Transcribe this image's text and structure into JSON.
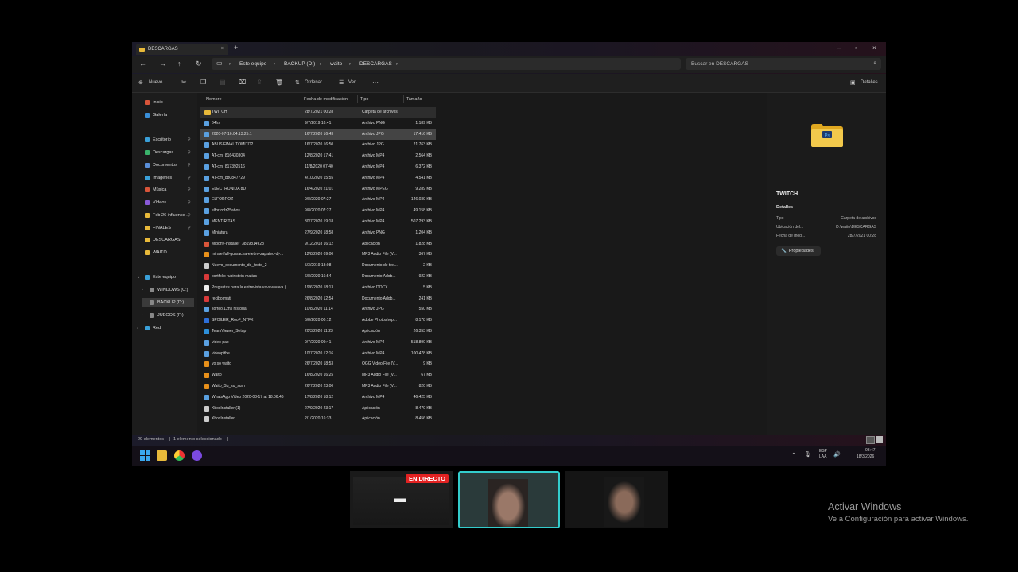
{
  "window": {
    "tab_title": "DESCARGAS",
    "tab_close": "×",
    "new_tab": "+",
    "minimize": "–",
    "maximize": "▫",
    "close": "×"
  },
  "address": {
    "crumbs": [
      "Este equipo",
      "BACKUP (D:)",
      "waito",
      "DESCARGAS"
    ],
    "separator": "›",
    "search_placeholder": "Buscar en DESCARGAS"
  },
  "toolbar": {
    "new_label": "Nuevo",
    "sort_label": "Ordenar",
    "view_label": "Ver",
    "more_label": "···",
    "details_label": "Detalles"
  },
  "sidebar": {
    "items": [
      {
        "label": "Inicio",
        "color": "#d9553a",
        "pinned": false
      },
      {
        "label": "Galería",
        "color": "#3a8fd9",
        "pinned": false
      },
      {
        "label": "Escritorio",
        "color": "#3aa0d9",
        "pinned": true
      },
      {
        "label": "Descargas",
        "color": "#3ab36b",
        "pinned": true
      },
      {
        "label": "Documentos",
        "color": "#5a8fd9",
        "pinned": true
      },
      {
        "label": "Imágenes",
        "color": "#3aa0d9",
        "pinned": true
      },
      {
        "label": "Música",
        "color": "#d9553a",
        "pinned": true
      },
      {
        "label": "Vídeos",
        "color": "#8a5ad9",
        "pinned": true
      },
      {
        "label": "Feb 26 influence ...",
        "color": "#e8b93a",
        "pinned": true
      },
      {
        "label": "FINALES",
        "color": "#e8b93a",
        "pinned": true
      },
      {
        "label": "DESCARGAS",
        "color": "#e8b93a",
        "pinned": false
      },
      {
        "label": "WAITO",
        "color": "#e8b93a",
        "pinned": false
      }
    ],
    "tree": [
      {
        "label": "Este equipo",
        "color": "#3aa0d9"
      },
      {
        "label": "WINDOWS (C:)",
        "color": "#888888"
      },
      {
        "label": "BACKUP (D:)",
        "color": "#888888"
      },
      {
        "label": "JUEGOS (F:)",
        "color": "#888888"
      },
      {
        "label": "Red",
        "color": "#3aa0d9"
      }
    ]
  },
  "columns": {
    "name": "Nombre",
    "date": "Fecha de modificación",
    "type": "Tipo",
    "size": "Tamaño"
  },
  "files": [
    {
      "name": "TWITCH",
      "date": "28/7/2021 00:28",
      "type": "Carpeta de archivos",
      "size": "",
      "color": "#e8b93a"
    },
    {
      "name": "64hs",
      "date": "9/7/2019 18:41",
      "type": "Archivo PNG",
      "size": "1.189 KB",
      "color": "#5aa0e0"
    },
    {
      "name": "2020-07-16.04.13.25.1",
      "date": "16/7/2020 16:43",
      "type": "Archivo JPG",
      "size": "17.416 KB",
      "color": "#5aa0e0"
    },
    {
      "name": "ABUS FINAL TOMITO2",
      "date": "16/7/2020 16:50",
      "type": "Archivo JPG",
      "size": "21.763 KB",
      "color": "#5aa0e0"
    },
    {
      "name": "AT-cm_816430304",
      "date": "12/8/2020 17:41",
      "type": "Archivo MP4",
      "size": "2.564 KB",
      "color": "#5aa0e0"
    },
    {
      "name": "AT-cm_817392516",
      "date": "11/8/2020 07:40",
      "type": "Archivo MP4",
      "size": "6.372 KB",
      "color": "#5aa0e0"
    },
    {
      "name": "AT-cm_880847729",
      "date": "4/10/2020 15:55",
      "type": "Archivo MP4",
      "size": "4.541 KB",
      "color": "#5aa0e0"
    },
    {
      "name": "ELECTRONIDA 8D",
      "date": "16/4/2020 21:01",
      "type": "Archivo MPEG",
      "size": "9.289 KB",
      "color": "#5aa0e0"
    },
    {
      "name": "ELFORROZ",
      "date": "9/8/2020 07:27",
      "type": "Archivo MP4",
      "size": "146.039 KB",
      "color": "#5aa0e0"
    },
    {
      "name": "elforrodz25años",
      "date": "9/8/2020 07:27",
      "type": "Archivo MP4",
      "size": "49.158 KB",
      "color": "#5aa0e0"
    },
    {
      "name": "MENTIRITAS",
      "date": "30/7/2020 19:18",
      "type": "Archivo MP4",
      "size": "507.293 KB",
      "color": "#5aa0e0"
    },
    {
      "name": "Miniatura",
      "date": "27/9/2020 18:58",
      "type": "Archivo PNG",
      "size": "1.204 KB",
      "color": "#5aa0e0"
    },
    {
      "name": "Mipony-Installer_3819814928",
      "date": "9/12/2018 16:12",
      "type": "Aplicación",
      "size": "1.828 KB",
      "color": "#d9553a"
    },
    {
      "name": "mirale-full-guaracha-eleteo-zapateo-dj-...",
      "date": "12/8/2020 09:00",
      "type": "MP3 Audio File (V...",
      "size": "367 KB",
      "color": "#e8901a"
    },
    {
      "name": "Nuevo_documento_de_texto_2",
      "date": "5/3/2019 13:08",
      "type": "Documento de tex...",
      "size": "2 KB",
      "color": "#cccccc"
    },
    {
      "name": "portfolio rubinstein matias",
      "date": "6/8/2020 16:54",
      "type": "Documento Adob...",
      "size": "922 KB",
      "color": "#d93a3a"
    },
    {
      "name": "Preguntas para la entrevista vavavavava (...",
      "date": "19/6/2020 18:13",
      "type": "Archivo DOCX",
      "size": "5 KB",
      "color": "#eeeeee"
    },
    {
      "name": "recibo mati",
      "date": "26/8/2020 12:54",
      "type": "Documento Adob...",
      "size": "241 KB",
      "color": "#d93a3a"
    },
    {
      "name": "sorteo 12hs historia",
      "date": "10/8/2020 11:14",
      "type": "Archivo JPG",
      "size": "550 KB",
      "color": "#5aa0e0"
    },
    {
      "name": "SPOILER_RooF_NTFX",
      "date": "6/8/2020 00:12",
      "type": "Adobe Photoshop...",
      "size": "8.178 KB",
      "color": "#2d6fd9"
    },
    {
      "name": "TeamViewer_Setup",
      "date": "20/3/2020 11:23",
      "type": "Aplicación",
      "size": "26.353 KB",
      "color": "#2d8fd9"
    },
    {
      "name": "video pao",
      "date": "9/7/2020 09:41",
      "type": "Archivo MP4",
      "size": "518.890 KB",
      "color": "#5aa0e0"
    },
    {
      "name": "videopithe",
      "date": "10/7/2020 12:16",
      "type": "Archivo MP4",
      "size": "100.478 KB",
      "color": "#5aa0e0"
    },
    {
      "name": "vo so waito",
      "date": "26/7/2020 18:53",
      "type": "OGG Video File (V...",
      "size": "9 KB",
      "color": "#e8901a"
    },
    {
      "name": "Waito",
      "date": "16/8/2020 16:25",
      "type": "MP3 Audio File (V...",
      "size": "67 KB",
      "color": "#e8901a"
    },
    {
      "name": "Waito_Su_su_sum",
      "date": "26/7/2020 23:00",
      "type": "MP3 Audio File (V...",
      "size": "820 KB",
      "color": "#e8901a"
    },
    {
      "name": "WhatsApp Video 2020-08-17 at 18.06.46",
      "date": "17/8/2020 18:12",
      "type": "Archivo MP4",
      "size": "46.425 KB",
      "color": "#5aa0e0"
    },
    {
      "name": "XboxInstaller (1)",
      "date": "27/9/2020 23:17",
      "type": "Aplicación",
      "size": "8.470 KB",
      "color": "#cccccc"
    },
    {
      "name": "XboxInstaller",
      "date": "2/1/2020 16:33",
      "type": "Aplicación",
      "size": "8.456 KB",
      "color": "#cccccc"
    }
  ],
  "details": {
    "title": "TWITCH",
    "section": "Detalles",
    "rows": [
      {
        "key": "Tipo",
        "value": "Carpeta de archivos"
      },
      {
        "key": "Ubicación del...",
        "value": "D:\\waito\\DESCARGAS"
      },
      {
        "key": "Fecha de mod...",
        "value": "28/7/2021 00:28"
      }
    ],
    "properties_label": "Propiedades"
  },
  "status": {
    "count": "29 elementos",
    "selected": "1 elemento seleccionado"
  },
  "taskbar": {
    "lang_top": "ESP",
    "lang_bottom": "LAA",
    "time": "03:47",
    "date": "18/3/2026"
  },
  "stream": {
    "live_label": "EN DIRECTO"
  },
  "watermark": {
    "line1": "Activar Windows",
    "line2": "Ve a Configuración para activar Windows."
  }
}
